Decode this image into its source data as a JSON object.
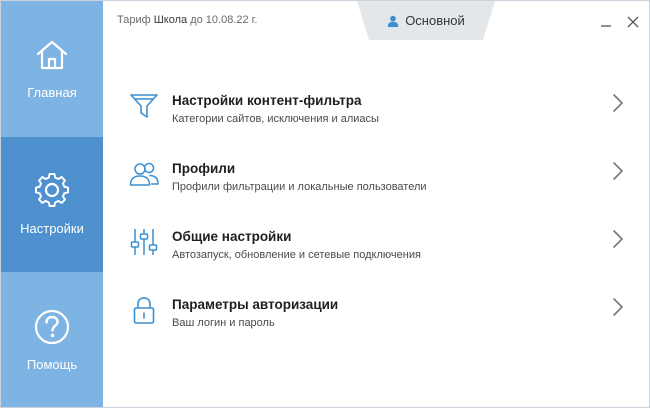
{
  "header": {
    "tariff_prefix": "Тариф",
    "tariff_name": "Школа",
    "tariff_until": "до 10.08.22 г.",
    "profile_name": "Основной",
    "profile_icon": "user-icon"
  },
  "window_controls": {
    "minimize_icon": "minimize-icon",
    "close_icon": "close-icon"
  },
  "sidebar": {
    "items": [
      {
        "label": "Главная",
        "icon": "home-icon",
        "active": false
      },
      {
        "label": "Настройки",
        "icon": "gear-icon",
        "active": true
      },
      {
        "label": "Помощь",
        "icon": "help-icon",
        "active": false
      }
    ]
  },
  "menu": {
    "items": [
      {
        "title": "Настройки контент-фильтра",
        "subtitle": "Категории сайтов, исключения и алиасы",
        "icon": "filter-icon"
      },
      {
        "title": "Профили",
        "subtitle": "Профили фильтрации и локальные пользователи",
        "icon": "users-icon"
      },
      {
        "title": "Общие настройки",
        "subtitle": "Автозапуск, обновление и сетевые подключения",
        "icon": "sliders-icon"
      },
      {
        "title": "Параметры авторизации",
        "subtitle": "Ваш логин и пароль",
        "icon": "lock-icon"
      }
    ]
  },
  "colors": {
    "sidebar": "#7eb4e3",
    "sidebar_active": "#4f91cf",
    "accent_icon": "#3a8fd0",
    "profile_tab": "#e4e7ea"
  }
}
